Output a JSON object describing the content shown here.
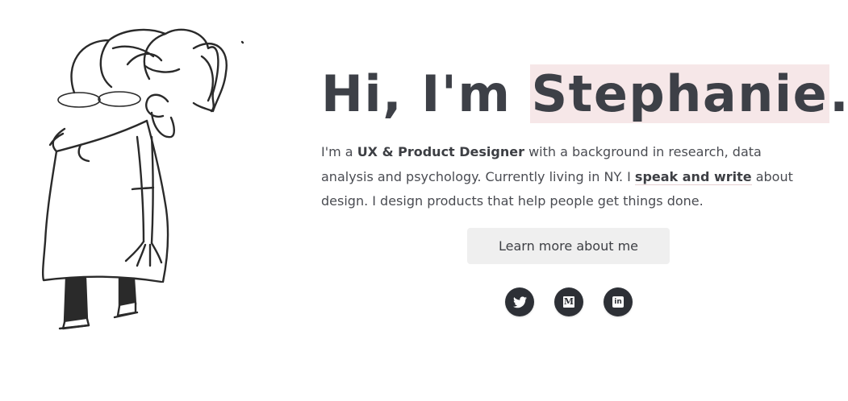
{
  "hero": {
    "greeting": "Hi, I'm ",
    "name": "Stephanie",
    "punctuation": ".",
    "intro_1": "I'm a ",
    "role": "UX & Product Designer",
    "intro_2": " with a background in research, data analysis and psychology. Currently living in NY. I ",
    "link_text": "speak and write",
    "intro_3": " about design. I design products that help people get things done.",
    "cta_label": "Learn more about me"
  },
  "socials": [
    {
      "name": "twitter",
      "icon": "twitter-icon"
    },
    {
      "name": "medium",
      "icon": "medium-icon",
      "glyph": "M"
    },
    {
      "name": "linkedin",
      "icon": "linkedin-icon",
      "glyph": "in"
    }
  ],
  "colors": {
    "text": "#3d4047",
    "highlight": "#f6e7e8",
    "button_bg": "#efefef",
    "social_bg": "#2d3036"
  }
}
